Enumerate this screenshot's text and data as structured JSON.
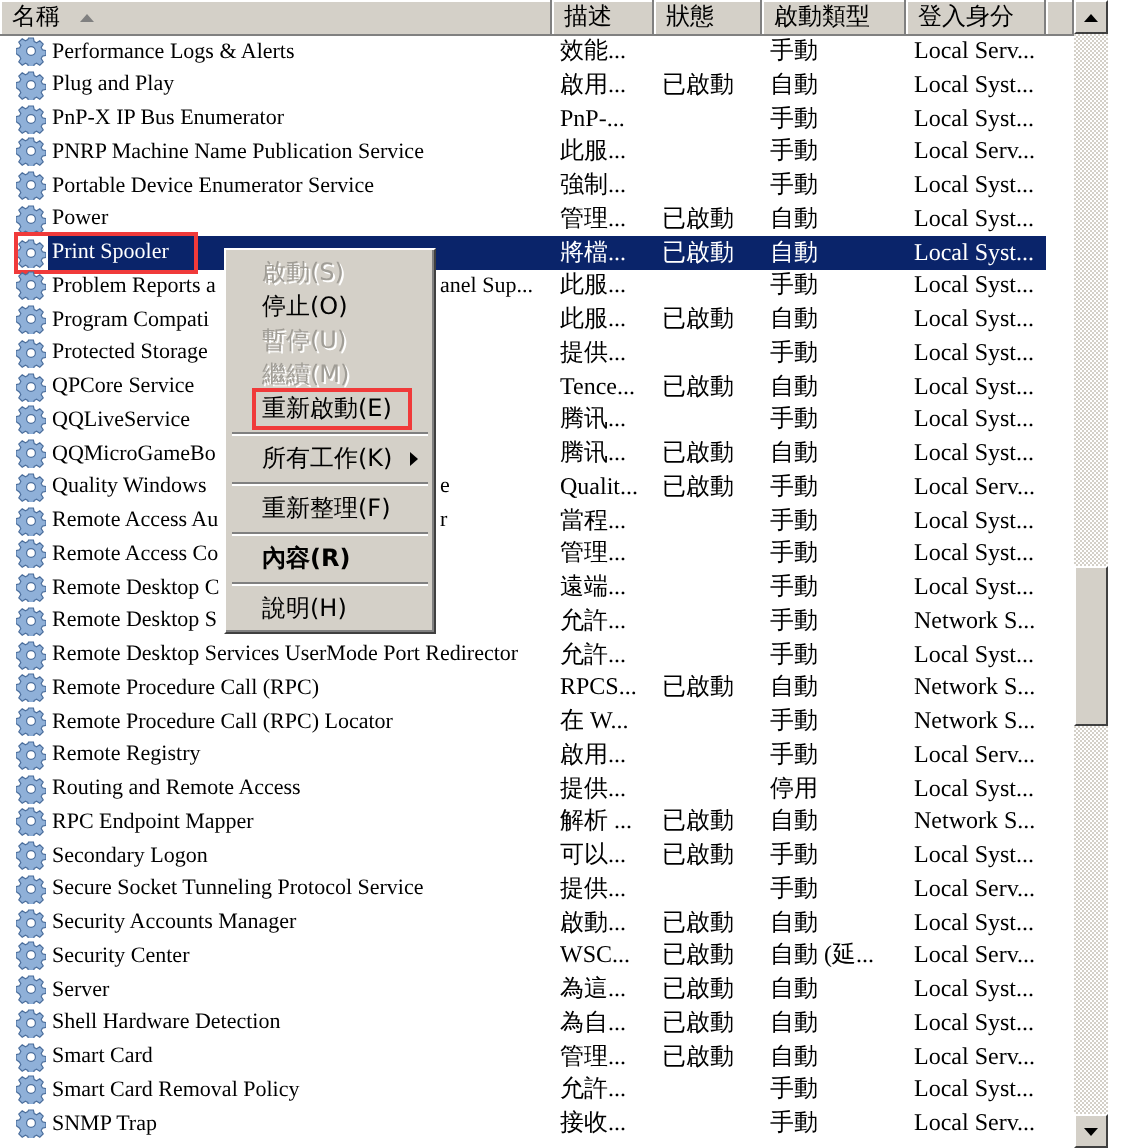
{
  "table": {
    "columns": [
      {
        "label": "名稱",
        "sorted": true
      },
      {
        "label": "描述",
        "sorted": false
      },
      {
        "label": "狀態",
        "sorted": false
      },
      {
        "label": "啟動類型",
        "sorted": false
      },
      {
        "label": "登入身分",
        "sorted": false
      }
    ],
    "rows": [
      {
        "name": "Performance Logs & Alerts",
        "description": "效能...",
        "status": "",
        "startup": "手動",
        "logon": "Local Serv...",
        "selected": false,
        "annotated": false
      },
      {
        "name": "Plug and Play",
        "description": "啟用...",
        "status": "已啟動",
        "startup": "自動",
        "logon": "Local Syst...",
        "selected": false,
        "annotated": false
      },
      {
        "name": "PnP-X IP Bus Enumerator",
        "description": "PnP-...",
        "status": "",
        "startup": "手動",
        "logon": "Local Syst...",
        "selected": false,
        "annotated": false
      },
      {
        "name": "PNRP Machine Name Publication Service",
        "description": "此服...",
        "status": "",
        "startup": "手動",
        "logon": "Local Serv...",
        "selected": false,
        "annotated": false
      },
      {
        "name": "Portable Device Enumerator Service",
        "description": "強制...",
        "status": "",
        "startup": "手動",
        "logon": "Local Syst...",
        "selected": false,
        "annotated": false
      },
      {
        "name": "Power",
        "description": "管理...",
        "status": "已啟動",
        "startup": "自動",
        "logon": "Local Syst...",
        "selected": false,
        "annotated": false
      },
      {
        "name": "Print Spooler",
        "description": "將檔...",
        "status": "已啟動",
        "startup": "自動",
        "logon": "Local Syst...",
        "selected": true,
        "annotated": true
      },
      {
        "name": "Problem Reports a",
        "name_tail": "anel Sup...",
        "description": "此服...",
        "status": "",
        "startup": "手動",
        "logon": "Local Syst...",
        "selected": false,
        "annotated": false
      },
      {
        "name": "Program Compati",
        "description": "此服...",
        "status": "已啟動",
        "startup": "自動",
        "logon": "Local Syst...",
        "selected": false,
        "annotated": false
      },
      {
        "name": "Protected Storage",
        "description": "提供...",
        "status": "",
        "startup": "手動",
        "logon": "Local Syst...",
        "selected": false,
        "annotated": false
      },
      {
        "name": "QPCore Service",
        "description": "Tence...",
        "status": "已啟動",
        "startup": "自動",
        "logon": "Local Syst...",
        "selected": false,
        "annotated": false
      },
      {
        "name": "QQLiveService",
        "description": "腾讯...",
        "status": "",
        "startup": "手動",
        "logon": "Local Syst...",
        "selected": false,
        "annotated": false
      },
      {
        "name": "QQMicroGameBo",
        "description": "腾讯...",
        "status": "已啟動",
        "startup": "自動",
        "logon": "Local Syst...",
        "selected": false,
        "annotated": false
      },
      {
        "name": "Quality Windows",
        "name_tail": "e",
        "description": "Qualit...",
        "status": "已啟動",
        "startup": "手動",
        "logon": "Local Serv...",
        "selected": false,
        "annotated": false
      },
      {
        "name": "Remote Access Au",
        "name_tail": "r",
        "description": "當程...",
        "status": "",
        "startup": "手動",
        "logon": "Local Syst...",
        "selected": false,
        "annotated": false
      },
      {
        "name": "Remote Access Co",
        "description": "管理...",
        "status": "",
        "startup": "手動",
        "logon": "Local Syst...",
        "selected": false,
        "annotated": false
      },
      {
        "name": "Remote Desktop C",
        "description": "遠端...",
        "status": "",
        "startup": "手動",
        "logon": "Local Syst...",
        "selected": false,
        "annotated": false
      },
      {
        "name": "Remote Desktop S",
        "description": "允許...",
        "status": "",
        "startup": "手動",
        "logon": "Network S...",
        "selected": false,
        "annotated": false
      },
      {
        "name": "Remote Desktop Services UserMode Port Redirector",
        "description": "允許...",
        "status": "",
        "startup": "手動",
        "logon": "Local Syst...",
        "selected": false,
        "annotated": false
      },
      {
        "name": "Remote Procedure Call (RPC)",
        "description": "RPCS...",
        "status": "已啟動",
        "startup": "自動",
        "logon": "Network S...",
        "selected": false,
        "annotated": false
      },
      {
        "name": "Remote Procedure Call (RPC) Locator",
        "description": "在 W...",
        "status": "",
        "startup": "手動",
        "logon": "Network S...",
        "selected": false,
        "annotated": false
      },
      {
        "name": "Remote Registry",
        "description": "啟用...",
        "status": "",
        "startup": "手動",
        "logon": "Local Serv...",
        "selected": false,
        "annotated": false
      },
      {
        "name": "Routing and Remote Access",
        "description": "提供...",
        "status": "",
        "startup": "停用",
        "logon": "Local Syst...",
        "selected": false,
        "annotated": false
      },
      {
        "name": "RPC Endpoint Mapper",
        "description": "解析 ...",
        "status": "已啟動",
        "startup": "自動",
        "logon": "Network S...",
        "selected": false,
        "annotated": false
      },
      {
        "name": "Secondary Logon",
        "description": "可以...",
        "status": "已啟動",
        "startup": "手動",
        "logon": "Local Syst...",
        "selected": false,
        "annotated": false
      },
      {
        "name": "Secure Socket Tunneling Protocol Service",
        "description": "提供...",
        "status": "",
        "startup": "手動",
        "logon": "Local Serv...",
        "selected": false,
        "annotated": false
      },
      {
        "name": "Security Accounts Manager",
        "description": "啟動...",
        "status": "已啟動",
        "startup": "自動",
        "logon": "Local Syst...",
        "selected": false,
        "annotated": false
      },
      {
        "name": "Security Center",
        "description": "WSC...",
        "status": "已啟動",
        "startup": "自動 (延...",
        "logon": "Local Serv...",
        "selected": false,
        "annotated": false
      },
      {
        "name": "Server",
        "description": "為這...",
        "status": "已啟動",
        "startup": "自動",
        "logon": "Local Syst...",
        "selected": false,
        "annotated": false
      },
      {
        "name": "Shell Hardware Detection",
        "description": "為自...",
        "status": "已啟動",
        "startup": "自動",
        "logon": "Local Syst...",
        "selected": false,
        "annotated": false
      },
      {
        "name": "Smart Card",
        "description": "管理...",
        "status": "已啟動",
        "startup": "自動",
        "logon": "Local Serv...",
        "selected": false,
        "annotated": false
      },
      {
        "name": "Smart Card Removal Policy",
        "description": "允許...",
        "status": "",
        "startup": "手動",
        "logon": "Local Syst...",
        "selected": false,
        "annotated": false
      },
      {
        "name": "SNMP Trap",
        "description": "接收...",
        "status": "",
        "startup": "手動",
        "logon": "Local Serv...",
        "selected": false,
        "annotated": false
      }
    ]
  },
  "context_menu": {
    "items": [
      {
        "kind": "item",
        "label": "啟動(S)",
        "disabled": true,
        "default": false,
        "submenu": false,
        "annotated": false
      },
      {
        "kind": "item",
        "label": "停止(O)",
        "disabled": false,
        "default": false,
        "submenu": false,
        "annotated": false
      },
      {
        "kind": "item",
        "label": "暫停(U)",
        "disabled": true,
        "default": false,
        "submenu": false,
        "annotated": false
      },
      {
        "kind": "item",
        "label": "繼續(M)",
        "disabled": true,
        "default": false,
        "submenu": false,
        "annotated": false
      },
      {
        "kind": "item",
        "label": "重新啟動(E)",
        "disabled": false,
        "default": false,
        "submenu": false,
        "annotated": true
      },
      {
        "kind": "separator"
      },
      {
        "kind": "item",
        "label": "所有工作(K)",
        "disabled": false,
        "default": false,
        "submenu": true,
        "annotated": false
      },
      {
        "kind": "separator"
      },
      {
        "kind": "item",
        "label": "重新整理(F)",
        "disabled": false,
        "default": false,
        "submenu": false,
        "annotated": false
      },
      {
        "kind": "separator"
      },
      {
        "kind": "item",
        "label": "內容(R)",
        "disabled": false,
        "default": true,
        "submenu": false,
        "annotated": false
      },
      {
        "kind": "separator"
      },
      {
        "kind": "item",
        "label": "說明(H)",
        "disabled": false,
        "default": false,
        "submenu": false,
        "annotated": false
      }
    ]
  }
}
